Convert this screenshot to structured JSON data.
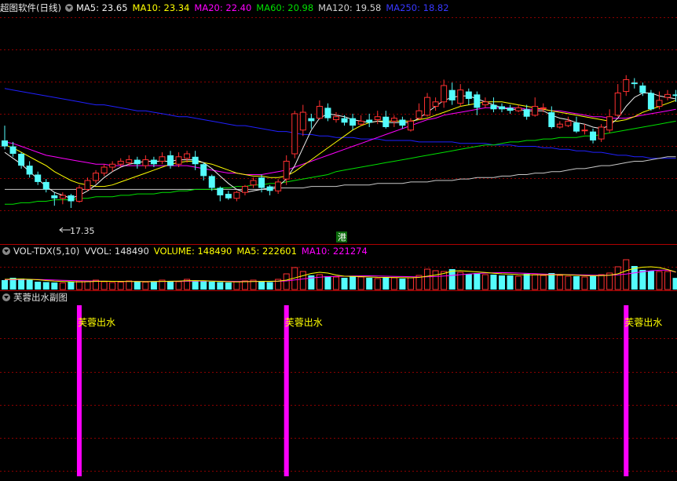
{
  "main_header": {
    "title": "超图软件(日线)",
    "ma5": "MA5: 23.65",
    "ma10": "MA10: 23.34",
    "ma20": "MA20: 22.40",
    "ma60": "MA60: 20.98",
    "ma120": "MA120: 19.58",
    "ma250": "MA250: 18.82"
  },
  "vol_header": {
    "indicator": "VOL-TDX(5,10)",
    "vvol": "VVOL: 148490",
    "volume": "VOLUME: 148490",
    "ma5": "MA5: 222601",
    "ma10": "MA10: 221274"
  },
  "sub_header": {
    "title": "芙蓉出水副图"
  },
  "low_label": "17.35",
  "gang_badge": "港",
  "signal_label": "芙蓉出水",
  "colors": {
    "up": "#ff3030",
    "down": "#54fcfc",
    "ma5": "#f0f0f0",
    "ma10": "#ffff00",
    "ma20": "#ff00ff",
    "ma60": "#00e000",
    "ma120": "#c8c8c8",
    "ma250": "#2020ff",
    "signal": "#ff00ff",
    "grid": "#8b0000"
  },
  "chart_data": {
    "type": "candlestick",
    "price_ylim": [
      15.5,
      26.5
    ],
    "candles": [
      [
        21.9,
        21.5,
        22.9,
        21.3
      ],
      [
        21.5,
        21.0,
        21.8,
        20.8
      ],
      [
        21.0,
        20.2,
        21.1,
        20.0
      ],
      [
        20.2,
        19.6,
        20.5,
        19.4
      ],
      [
        19.6,
        19.1,
        19.8,
        18.9
      ],
      [
        19.1,
        18.6,
        19.3,
        18.4
      ],
      [
        18.2,
        18.0,
        18.4,
        17.5
      ],
      [
        18.0,
        18.2,
        18.4,
        17.6
      ],
      [
        18.2,
        17.8,
        18.3,
        17.35
      ],
      [
        17.8,
        18.7,
        18.9,
        17.7
      ],
      [
        18.6,
        19.2,
        19.4,
        18.5
      ],
      [
        19.2,
        19.7,
        19.9,
        19.0
      ],
      [
        19.7,
        20.1,
        20.3,
        19.5
      ],
      [
        20.1,
        20.3,
        20.5,
        19.8
      ],
      [
        20.3,
        20.5,
        20.7,
        20.1
      ],
      [
        20.4,
        20.6,
        20.9,
        20.2
      ],
      [
        20.6,
        20.3,
        20.8,
        20.0
      ],
      [
        20.2,
        20.6,
        20.9,
        20.0
      ],
      [
        20.6,
        20.3,
        20.8,
        20.1
      ],
      [
        20.5,
        20.8,
        21.1,
        20.3
      ],
      [
        20.9,
        20.2,
        21.2,
        20.0
      ],
      [
        20.3,
        20.8,
        21.1,
        20.1
      ],
      [
        20.7,
        21.0,
        21.2,
        20.4
      ],
      [
        20.8,
        20.3,
        21.2,
        19.9
      ],
      [
        20.3,
        19.5,
        20.4,
        19.2
      ],
      [
        19.5,
        18.7,
        19.6,
        18.5
      ],
      [
        18.7,
        18.2,
        18.8,
        17.8
      ],
      [
        18.3,
        18.0,
        18.5,
        17.9
      ],
      [
        18.0,
        18.4,
        18.5,
        17.8
      ],
      [
        18.4,
        18.8,
        18.9,
        18.2
      ],
      [
        18.9,
        19.2,
        19.4,
        18.7
      ],
      [
        19.4,
        18.7,
        19.6,
        18.4
      ],
      [
        18.8,
        18.5,
        18.9,
        18.2
      ],
      [
        18.5,
        19.1,
        19.3,
        18.3
      ],
      [
        19.3,
        20.5,
        20.9,
        18.9
      ],
      [
        21.0,
        23.7,
        23.9,
        20.7
      ],
      [
        22.6,
        23.8,
        24.3,
        22.2
      ],
      [
        23.4,
        23.2,
        23.7,
        22.7
      ],
      [
        23.4,
        24.2,
        24.6,
        23.3
      ],
      [
        24.1,
        23.4,
        24.4,
        23.2
      ],
      [
        23.3,
        23.5,
        23.8,
        23.1
      ],
      [
        23.4,
        23.1,
        23.6,
        22.9
      ],
      [
        23.4,
        22.9,
        23.7,
        22.6
      ],
      [
        23.0,
        23.2,
        23.6,
        22.9
      ],
      [
        23.3,
        23.1,
        23.7,
        22.8
      ],
      [
        23.3,
        23.5,
        23.9,
        23.0
      ],
      [
        23.5,
        22.8,
        23.9,
        22.7
      ],
      [
        23.2,
        23.4,
        23.6,
        22.8
      ],
      [
        23.3,
        22.9,
        23.5,
        22.7
      ],
      [
        22.6,
        23.2,
        23.4,
        22.5
      ],
      [
        23.4,
        23.9,
        24.4,
        23.3
      ],
      [
        23.6,
        24.8,
        25.1,
        23.5
      ],
      [
        24.2,
        24.5,
        24.8,
        23.9
      ],
      [
        24.5,
        25.6,
        26.0,
        24.1
      ],
      [
        25.3,
        24.6,
        25.8,
        24.3
      ],
      [
        24.4,
        25.3,
        25.7,
        24.2
      ],
      [
        25.2,
        24.7,
        25.4,
        24.3
      ],
      [
        25.0,
        24.1,
        25.2,
        23.6
      ],
      [
        24.3,
        24.5,
        24.8,
        24.1
      ],
      [
        24.3,
        24.0,
        24.8,
        23.8
      ],
      [
        24.2,
        24.0,
        24.4,
        23.8
      ],
      [
        24.1,
        23.9,
        24.3,
        23.7
      ],
      [
        23.9,
        24.1,
        24.3,
        23.8
      ],
      [
        24.0,
        23.5,
        24.3,
        23.3
      ],
      [
        23.6,
        24.2,
        24.8,
        23.5
      ],
      [
        24.1,
        24.1,
        24.4,
        23.8
      ],
      [
        23.8,
        22.8,
        24.2,
        22.7
      ],
      [
        22.8,
        23.0,
        23.2,
        22.7
      ],
      [
        22.9,
        23.2,
        23.5,
        22.8
      ],
      [
        23.1,
        22.5,
        23.5,
        22.4
      ],
      [
        22.6,
        22.6,
        23.0,
        22.3
      ],
      [
        22.5,
        21.9,
        22.7,
        21.7
      ],
      [
        22.0,
        22.8,
        23.0,
        21.8
      ],
      [
        22.6,
        23.5,
        24.0,
        22.4
      ],
      [
        23.6,
        25.1,
        25.7,
        23.5
      ],
      [
        25.2,
        26.0,
        26.3,
        24.9
      ],
      [
        25.8,
        25.7,
        26.1,
        25.4
      ],
      [
        25.6,
        25.1,
        25.8,
        24.9
      ],
      [
        25.1,
        24.0,
        25.3,
        23.9
      ],
      [
        24.2,
        24.6,
        25.2,
        24.0
      ],
      [
        24.8,
        25.0,
        25.3,
        24.6
      ],
      [
        25.0,
        24.9,
        25.3,
        24.5
      ]
    ],
    "ma": {
      "ma5": [
        21.1,
        20.7,
        20.3,
        19.8,
        19.3,
        18.8,
        18.4,
        18.2,
        18.0,
        18.2,
        18.5,
        18.9,
        19.4,
        19.8,
        20.1,
        20.3,
        20.4,
        20.5,
        20.5,
        20.5,
        20.5,
        20.6,
        20.6,
        20.6,
        20.4,
        20.0,
        19.5,
        19.0,
        18.6,
        18.4,
        18.5,
        18.6,
        18.7,
        18.8,
        19.3,
        20.2,
        21.4,
        22.6,
        23.4,
        23.7,
        23.6,
        23.5,
        23.3,
        23.2,
        23.1,
        23.2,
        23.1,
        23.1,
        23.1,
        23.1,
        23.4,
        23.8,
        24.2,
        24.6,
        24.8,
        24.9,
        24.9,
        24.7,
        24.5,
        24.3,
        24.1,
        24.0,
        24.0,
        23.9,
        23.9,
        23.9,
        23.6,
        23.4,
        23.3,
        23.1,
        23.0,
        22.8,
        22.7,
        22.9,
        23.4,
        24.2,
        24.8,
        25.1,
        25.1,
        24.9,
        24.8,
        24.7
      ],
      "ma10": [
        21.6,
        21.4,
        21.1,
        20.8,
        20.5,
        20.2,
        19.8,
        19.5,
        19.2,
        19.0,
        18.9,
        18.8,
        18.8,
        18.9,
        19.1,
        19.3,
        19.5,
        19.7,
        19.9,
        20.1,
        20.3,
        20.4,
        20.5,
        20.5,
        20.4,
        20.3,
        20.1,
        19.9,
        19.7,
        19.6,
        19.5,
        19.5,
        19.4,
        19.4,
        19.5,
        19.8,
        20.2,
        20.6,
        21.0,
        21.4,
        21.8,
        22.2,
        22.6,
        22.9,
        23.1,
        23.2,
        23.2,
        23.2,
        23.2,
        23.2,
        23.3,
        23.4,
        23.6,
        23.8,
        24.0,
        24.2,
        24.3,
        24.4,
        24.5,
        24.5,
        24.5,
        24.4,
        24.3,
        24.2,
        24.1,
        24.0,
        23.9,
        23.8,
        23.7,
        23.6,
        23.5,
        23.4,
        23.3,
        23.2,
        23.2,
        23.3,
        23.5,
        23.8,
        24.0,
        24.2,
        24.4,
        24.6
      ],
      "ma20": [
        21.8,
        21.7,
        21.5,
        21.3,
        21.1,
        20.9,
        20.8,
        20.7,
        20.6,
        20.5,
        20.4,
        20.3,
        20.3,
        20.2,
        20.2,
        20.2,
        20.2,
        20.2,
        20.2,
        20.2,
        20.2,
        20.2,
        20.2,
        20.1,
        20.0,
        19.9,
        19.8,
        19.7,
        19.7,
        19.6,
        19.6,
        19.6,
        19.7,
        19.8,
        19.9,
        20.1,
        20.3,
        20.5,
        20.7,
        20.9,
        21.1,
        21.3,
        21.5,
        21.7,
        21.9,
        22.1,
        22.3,
        22.5,
        22.7,
        22.9,
        23.1,
        23.3,
        23.4,
        23.6,
        23.7,
        23.8,
        23.9,
        24.0,
        24.1,
        24.1,
        24.1,
        24.1,
        24.1,
        24.0,
        24.0,
        24.0,
        23.9,
        23.9,
        23.8,
        23.7,
        23.6,
        23.5,
        23.5,
        23.4,
        23.4,
        23.4,
        23.5,
        23.6,
        23.7,
        23.8,
        23.9,
        24.0
      ],
      "ma60": [
        17.6,
        17.6,
        17.7,
        17.7,
        17.8,
        17.8,
        17.9,
        17.9,
        17.9,
        18.0,
        18.0,
        18.1,
        18.1,
        18.1,
        18.2,
        18.2,
        18.3,
        18.3,
        18.3,
        18.4,
        18.4,
        18.5,
        18.5,
        18.6,
        18.6,
        18.6,
        18.7,
        18.7,
        18.8,
        18.8,
        18.9,
        18.9,
        19.0,
        19.0,
        19.1,
        19.2,
        19.3,
        19.4,
        19.5,
        19.6,
        19.8,
        19.9,
        20.0,
        20.1,
        20.2,
        20.3,
        20.4,
        20.5,
        20.6,
        20.7,
        20.8,
        20.9,
        21.0,
        21.1,
        21.2,
        21.3,
        21.4,
        21.5,
        21.6,
        21.6,
        21.7,
        21.8,
        21.8,
        21.9,
        21.9,
        22.0,
        22.0,
        22.1,
        22.1,
        22.1,
        22.2,
        22.2,
        22.3,
        22.4,
        22.5,
        22.6,
        22.7,
        22.8,
        22.9,
        23.0,
        23.1,
        23.2
      ],
      "ma120": [
        18.6,
        18.6,
        18.6,
        18.6,
        18.6,
        18.6,
        18.6,
        18.6,
        18.6,
        18.6,
        18.6,
        18.6,
        18.6,
        18.6,
        18.6,
        18.6,
        18.6,
        18.6,
        18.6,
        18.6,
        18.6,
        18.6,
        18.6,
        18.6,
        18.6,
        18.6,
        18.6,
        18.6,
        18.6,
        18.6,
        18.6,
        18.6,
        18.6,
        18.7,
        18.7,
        18.7,
        18.7,
        18.8,
        18.8,
        18.8,
        18.8,
        18.9,
        18.9,
        18.9,
        18.9,
        19.0,
        19.0,
        19.0,
        19.0,
        19.1,
        19.1,
        19.1,
        19.2,
        19.2,
        19.2,
        19.3,
        19.3,
        19.4,
        19.4,
        19.4,
        19.5,
        19.5,
        19.6,
        19.6,
        19.7,
        19.7,
        19.8,
        19.8,
        19.9,
        20.0,
        20.0,
        20.1,
        20.2,
        20.2,
        20.3,
        20.4,
        20.5,
        20.5,
        20.6,
        20.7,
        20.8,
        20.8
      ],
      "ma250": [
        25.4,
        25.3,
        25.2,
        25.1,
        25.0,
        24.9,
        24.8,
        24.7,
        24.6,
        24.5,
        24.4,
        24.3,
        24.3,
        24.2,
        24.1,
        24.0,
        23.9,
        23.9,
        23.8,
        23.7,
        23.6,
        23.5,
        23.5,
        23.4,
        23.3,
        23.2,
        23.1,
        23.0,
        22.9,
        22.9,
        22.8,
        22.7,
        22.6,
        22.5,
        22.5,
        22.4,
        22.3,
        22.3,
        22.2,
        22.2,
        22.1,
        22.1,
        22.1,
        22.0,
        22.0,
        22.0,
        21.9,
        21.9,
        21.9,
        21.9,
        21.8,
        21.8,
        21.8,
        21.8,
        21.8,
        21.7,
        21.7,
        21.7,
        21.7,
        21.6,
        21.6,
        21.6,
        21.5,
        21.5,
        21.5,
        21.4,
        21.4,
        21.3,
        21.3,
        21.2,
        21.2,
        21.1,
        21.1,
        21.0,
        20.9,
        20.9,
        20.8,
        20.8,
        20.7,
        20.7,
        20.7,
        20.7
      ]
    },
    "volume": [
      120000,
      150000,
      140000,
      130000,
      100000,
      95000,
      90000,
      85000,
      100000,
      110000,
      100000,
      120000,
      100000,
      90000,
      95000,
      110000,
      100000,
      95000,
      100000,
      120000,
      110000,
      100000,
      130000,
      110000,
      105000,
      100000,
      95000,
      90000,
      100000,
      110000,
      120000,
      100000,
      95000,
      130000,
      200000,
      280000,
      230000,
      180000,
      190000,
      170000,
      160000,
      150000,
      170000,
      160000,
      150000,
      140000,
      160000,
      150000,
      140000,
      150000,
      180000,
      260000,
      240000,
      230000,
      260000,
      220000,
      200000,
      210000,
      190000,
      190000,
      180000,
      180000,
      170000,
      200000,
      190000,
      180000,
      210000,
      180000,
      170000,
      170000,
      160000,
      170000,
      190000,
      210000,
      290000,
      380000,
      300000,
      250000,
      240000,
      230000,
      230000,
      148490
    ],
    "vol_ma5": [
      130000,
      132000,
      134000,
      130000,
      125000,
      115000,
      108000,
      104000,
      100000,
      98000,
      100000,
      104000,
      106000,
      105000,
      104000,
      103000,
      102000,
      100000,
      102000,
      104000,
      106000,
      108000,
      112000,
      114000,
      112000,
      108000,
      104000,
      100000,
      98000,
      100000,
      102000,
      104000,
      105000,
      107000,
      120000,
      148000,
      176000,
      205000,
      220000,
      210000,
      185000,
      170000,
      168000,
      165000,
      160000,
      156000,
      155000,
      154000,
      152000,
      150000,
      155000,
      170000,
      185000,
      205000,
      235000,
      240000,
      232000,
      225000,
      218000,
      208000,
      200000,
      196000,
      190000,
      188000,
      188000,
      187000,
      188000,
      190000,
      188000,
      182000,
      178000,
      176000,
      178000,
      182000,
      200000,
      240000,
      270000,
      285000,
      290000,
      280000,
      255000,
      222601
    ],
    "vol_ma10": [
      125000,
      126000,
      128000,
      129000,
      128000,
      125000,
      121000,
      118000,
      115000,
      112000,
      110000,
      108000,
      106000,
      105000,
      104000,
      104000,
      104000,
      103000,
      103000,
      103000,
      104000,
      105000,
      106000,
      107000,
      108000,
      107000,
      106000,
      105000,
      104000,
      104000,
      104000,
      104000,
      104000,
      105000,
      110000,
      122000,
      135000,
      148000,
      158000,
      165000,
      168000,
      170000,
      172000,
      174000,
      175000,
      173000,
      170000,
      168000,
      166000,
      164000,
      160000,
      162000,
      166000,
      172000,
      180000,
      190000,
      198000,
      205000,
      210000,
      214000,
      216000,
      214000,
      210000,
      206000,
      202000,
      198000,
      194000,
      192000,
      190000,
      188000,
      186000,
      184000,
      182000,
      184000,
      188000,
      198000,
      212000,
      228000,
      240000,
      246000,
      248000,
      221274
    ],
    "vol_ylim": [
      0,
      420000
    ],
    "signals_x_index": [
      9,
      34,
      75
    ],
    "signal_label": "芙蓉出水",
    "low_marker": {
      "index": 8,
      "value": 17.35
    }
  }
}
